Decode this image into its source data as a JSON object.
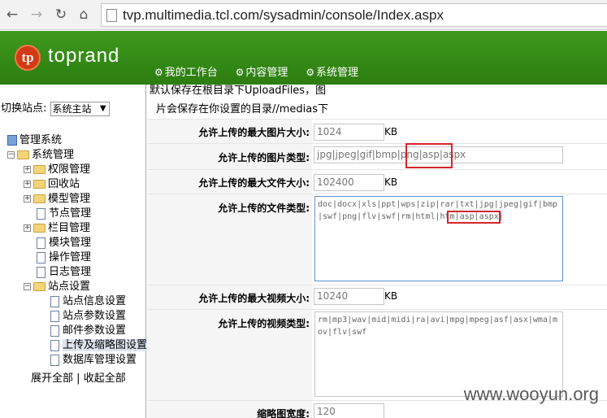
{
  "browser": {
    "url": "tvp.multimedia.tcl.com/sysadmin/console/Index.aspx",
    "back_icon": "arrow-left",
    "forward_icon": "arrow-right",
    "reload_icon": "reload",
    "home_icon": "home"
  },
  "header": {
    "logo_mark": "tp",
    "logo_text": "toprand",
    "menu": [
      "我的工作台",
      "内容管理",
      "系统管理"
    ]
  },
  "sidebar": {
    "switch_label": "切换站点:",
    "site_value": "系统主站",
    "tree": {
      "root": "管理系统",
      "system": "系统管理",
      "items": [
        "权限管理",
        "回收站",
        "模型管理",
        "节点管理",
        "栏目管理",
        "模块管理",
        "操作管理",
        "日志管理"
      ],
      "site_settings": "站点设置",
      "site_items": [
        "站点信息设置",
        "站点参数设置",
        "邮件参数设置",
        "上传及缩略图设置",
        "数据库管理设置"
      ]
    },
    "expand_all": "展开全部",
    "separator": "|",
    "collapse_all": "收起全部"
  },
  "form": {
    "hint_line1": "默认保存在根目录下UploadFiles，图",
    "hint_line2": "片会保存在你设置的目录//medias下",
    "max_image_label": "允许上传的最大图片大小:",
    "max_image_value": "1024",
    "max_image_unit": "KB",
    "image_types_label": "允许上传的图片类型:",
    "image_types_value": "jpg|jpeg|gif|bmp|png|asp|aspx",
    "max_file_label": "允许上传的最大文件大小:",
    "max_file_value": "102400",
    "max_file_unit": "KB",
    "file_types_label": "允许上传的文件类型:",
    "file_types_value": "doc|docx|xls|ppt|wps|zip|rar|txt|jpg|jpeg|gif|bmp|swf|png|flv|swf|rm|html|htm|asp|aspx|",
    "max_video_label": "允许上传的最大视频大小:",
    "max_video_value": "10240",
    "max_video_unit": "KB",
    "video_types_label": "允许上传的视频类型:",
    "video_types_value": "rm|mp3|wav|mid|midi|ra|avi|mpg|mpeg|asf|asx|wma|mov|flv|swf",
    "thumb_width_label": "缩略图宽度:",
    "thumb_width_value": "120"
  },
  "watermark": "www.wooyun.org",
  "colors": {
    "header_green": "#338a16",
    "highlight_red": "#d6252a"
  }
}
